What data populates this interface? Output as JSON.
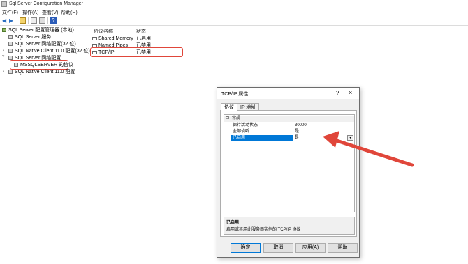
{
  "window": {
    "title": "Sql Server Configuration Manager"
  },
  "menu": [
    "文件(F)",
    "操作(A)",
    "查看(V)",
    "帮助(H)"
  ],
  "tree": {
    "items": [
      {
        "label": "SQL Server 配置管理器 (本地)"
      },
      {
        "label": "SQL Server 服务"
      },
      {
        "label": "SQL Server 网络配置(32 位)"
      },
      {
        "label": "SQL Native Client 11.0 配置(32 位)"
      },
      {
        "label": "SQL Server 网络配置"
      },
      {
        "label": "MSSQLSERVER 的协议"
      },
      {
        "label": "SQL Native Client 11.0 配置"
      }
    ]
  },
  "list": {
    "columns": [
      "协议名称",
      "状态"
    ],
    "rows": [
      {
        "name": "Shared Memory",
        "status": "已启用"
      },
      {
        "name": "Named Pipes",
        "status": "已禁用"
      },
      {
        "name": "TCP/IP",
        "status": "已禁用"
      }
    ]
  },
  "dialog": {
    "title": "TCP/IP 属性",
    "help_glyph": "?",
    "close_glyph": "×",
    "tabs": [
      "协议",
      "IP 地址"
    ],
    "group": "常规",
    "group_toggle": "⊟",
    "properties": [
      {
        "name": "保持活动状态",
        "value": "30000"
      },
      {
        "name": "全部侦听",
        "value": "是"
      },
      {
        "name": "已启用",
        "value": "是"
      }
    ],
    "description_title": "已启用",
    "description_text": "启用或禁用此服务器实例的 TCP/IP 协议",
    "buttons": [
      "确定",
      "取消",
      "应用(A)",
      "帮助"
    ]
  },
  "colors": {
    "highlight": "#e0463a",
    "selection": "#0078d7"
  }
}
